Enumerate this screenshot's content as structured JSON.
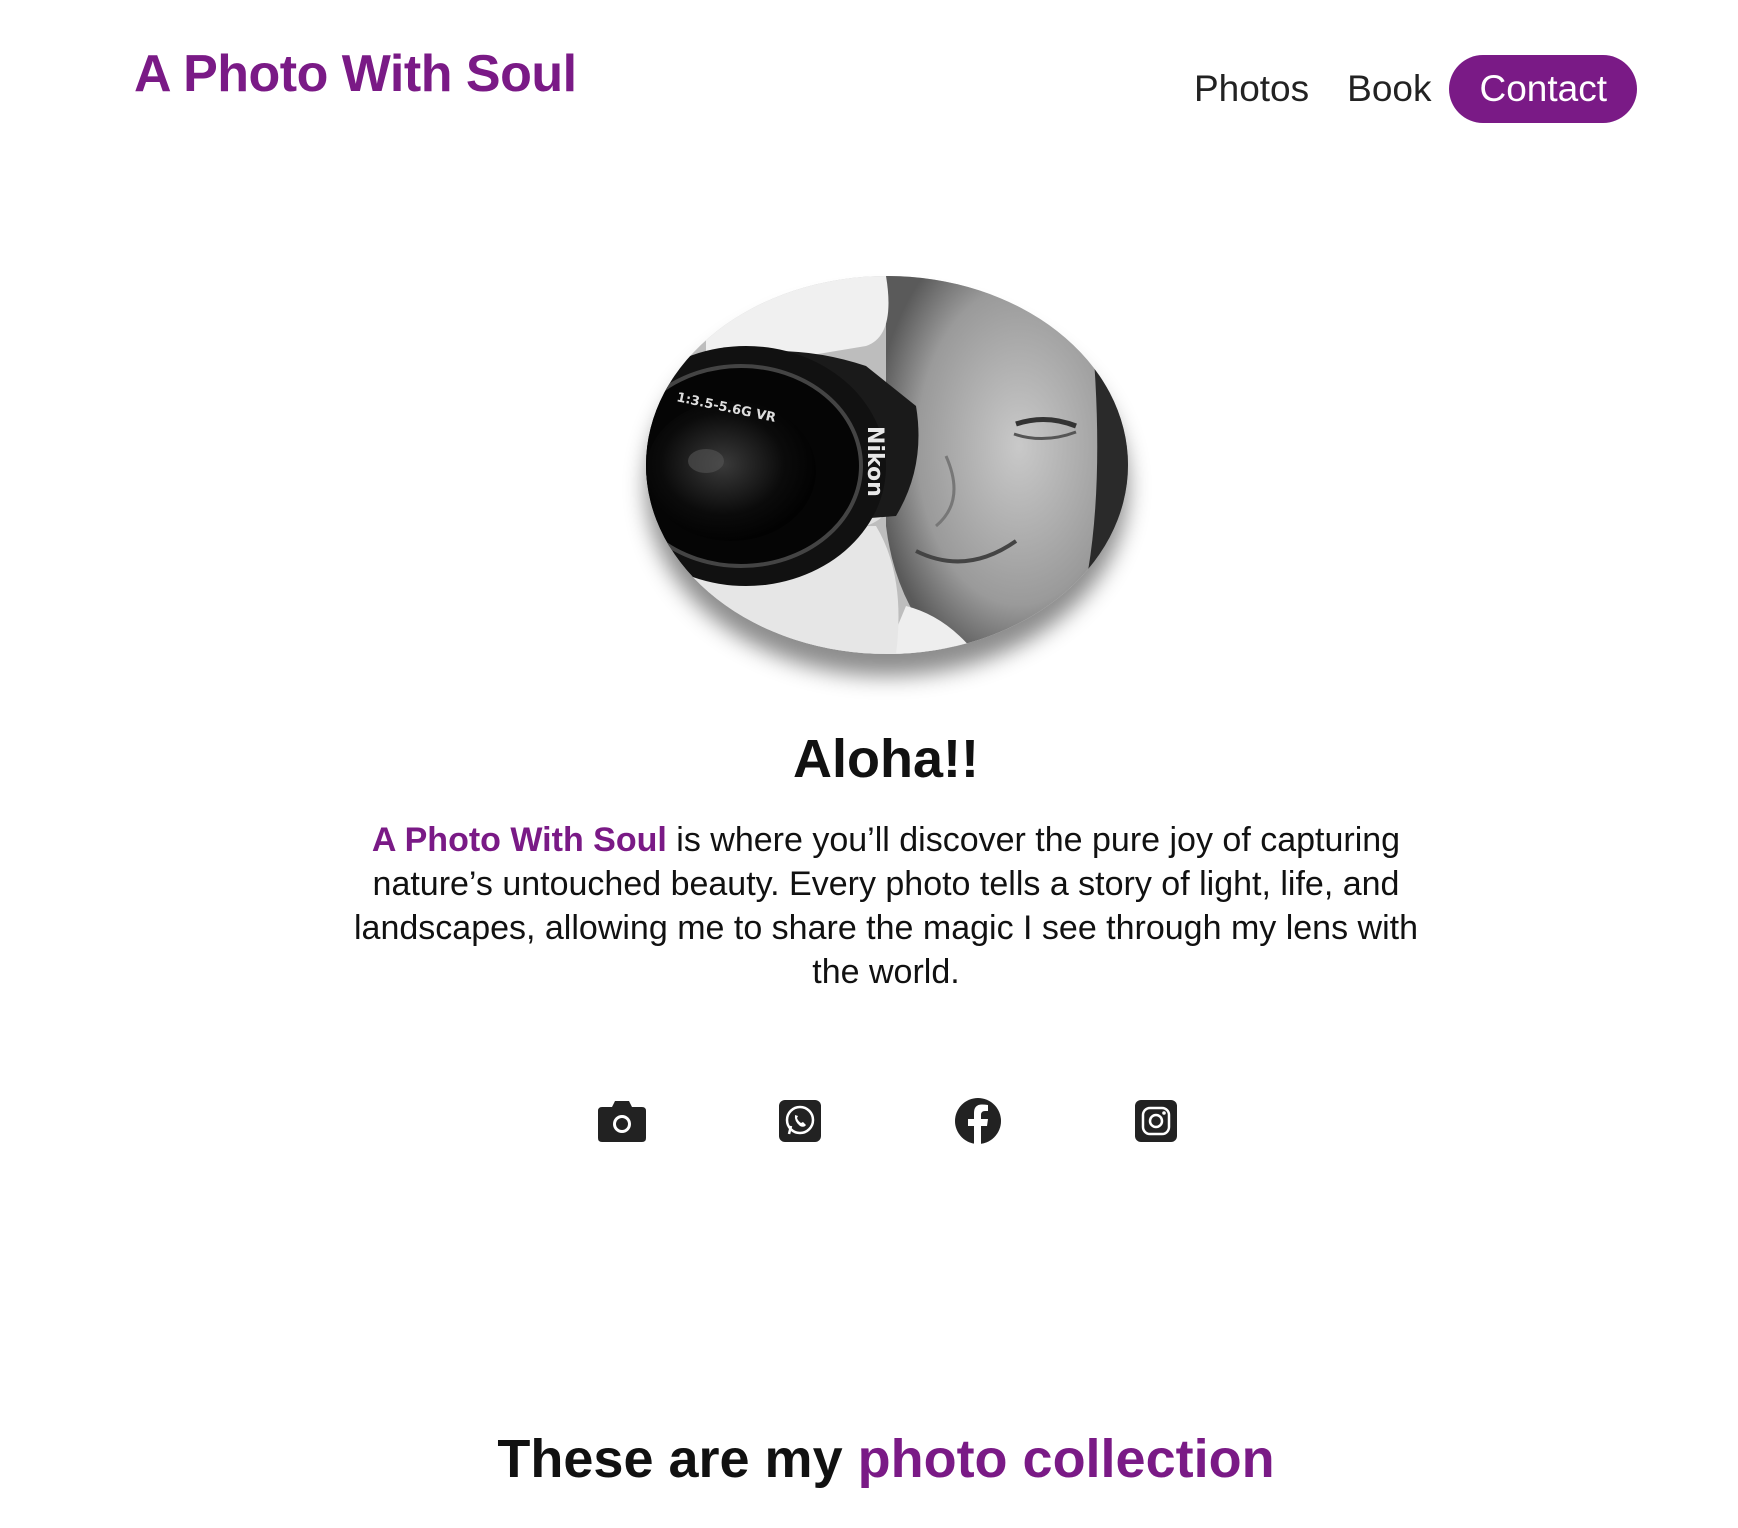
{
  "header": {
    "brand": "A Photo With Soul",
    "nav": {
      "photos": "Photos",
      "book": "Book",
      "contact": "Contact"
    }
  },
  "hero": {
    "greeting": "Aloha!!",
    "intro_brand": "A Photo With Soul",
    "intro_text": " is where you’ll discover the pure joy of capturing nature’s untouched beauty. Every photo tells a story of light, life, and landscapes, allowing me to share the magic I see through my lens with the world.",
    "lens_text": "1:3.5-5.6G VR",
    "camera_brand": "Nikon"
  },
  "socials": [
    {
      "icon": "camera-icon"
    },
    {
      "icon": "whatsapp-icon"
    },
    {
      "icon": "facebook-icon"
    },
    {
      "icon": "instagram-icon"
    }
  ],
  "collection": {
    "title_prefix": "These are my ",
    "title_accent": "photo collection"
  },
  "colors": {
    "accent": "#7a1a86",
    "text": "#111111",
    "icon": "#222222"
  }
}
